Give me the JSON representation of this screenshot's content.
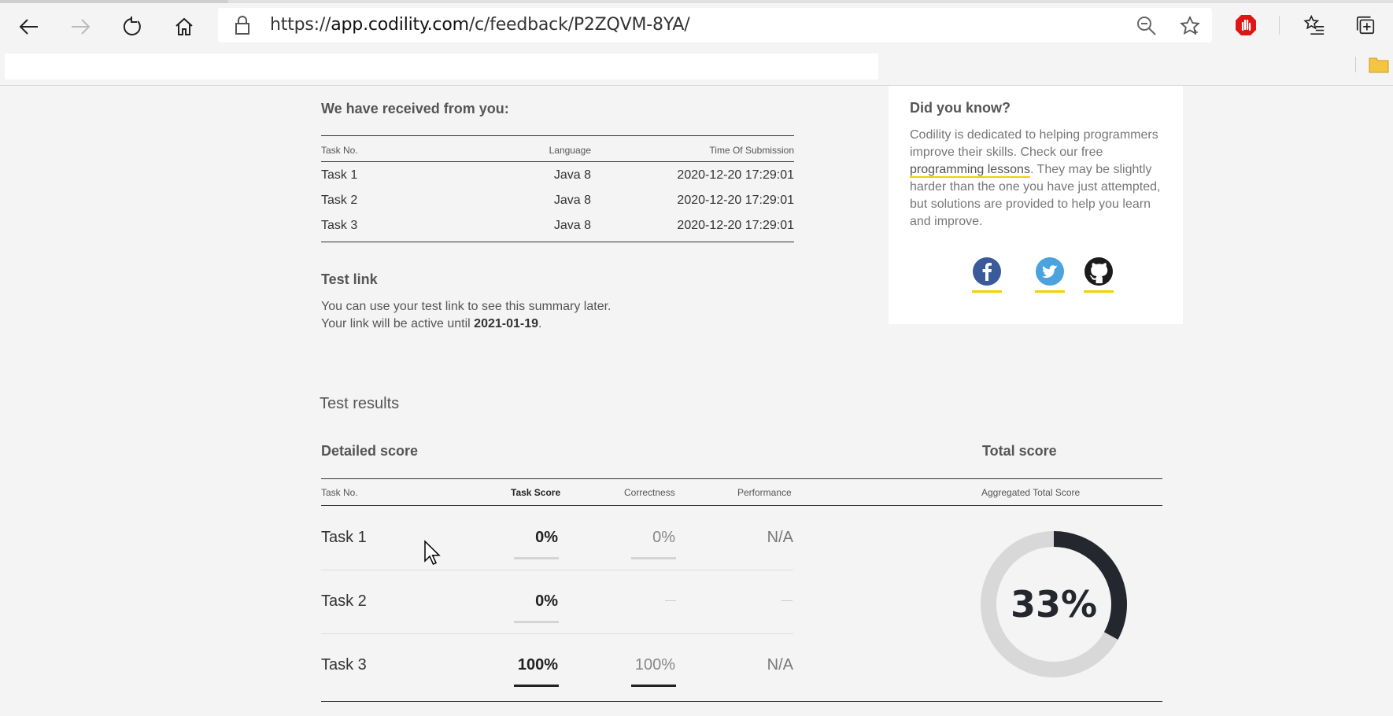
{
  "browser": {
    "url_prefix": "https://",
    "url_host": "app.codility.com",
    "url_path": "/c/feedback/P2ZQVM-8YA/"
  },
  "submissions": {
    "title": "We have received from you:",
    "columns": [
      "Task No.",
      "Language",
      "Time Of Submission"
    ],
    "rows": [
      {
        "task": "Task 1",
        "language": "Java 8",
        "time": "2020-12-20 17:29:01"
      },
      {
        "task": "Task 2",
        "language": "Java 8",
        "time": "2020-12-20 17:29:01"
      },
      {
        "task": "Task 3",
        "language": "Java 8",
        "time": "2020-12-20 17:29:01"
      }
    ]
  },
  "test_link": {
    "title": "Test link",
    "line1": "You can use your test link to see this summary later.",
    "line2_prefix": "Your link will be active until ",
    "active_until": "2021-01-19",
    "line2_suffix": "."
  },
  "did_you_know": {
    "title": "Did you know?",
    "text_before": "Codility is dedicated to helping programmers improve their skills. Check our free ",
    "link": "programming lessons",
    "text_after": ". They may be slightly harder than the one you have just attempted, but solutions are provided to help you learn and improve.",
    "social": [
      "facebook-icon",
      "twitter-icon",
      "github-icon"
    ]
  },
  "results": {
    "heading": "Test results",
    "detailed_title": "Detailed score",
    "total_title": "Total score",
    "columns": {
      "task": "Task No.",
      "task_score": "Task Score",
      "correctness": "Correctness",
      "performance": "Performance",
      "aggregated": "Aggregated Total Score"
    },
    "rows": [
      {
        "task": "Task 1",
        "score": "0%",
        "correctness": "0%",
        "performance": "N/A"
      },
      {
        "task": "Task 2",
        "score": "0%",
        "correctness": "",
        "performance": ""
      },
      {
        "task": "Task 3",
        "score": "100%",
        "correctness": "100%",
        "performance": "N/A"
      }
    ],
    "total": "33%",
    "total_fraction": 0.33
  },
  "colors": {
    "accent_yellow": "#f2d100",
    "donut_fill": "#24282e",
    "donut_track": "#d8d8d8",
    "background": "#f4f4f4"
  }
}
